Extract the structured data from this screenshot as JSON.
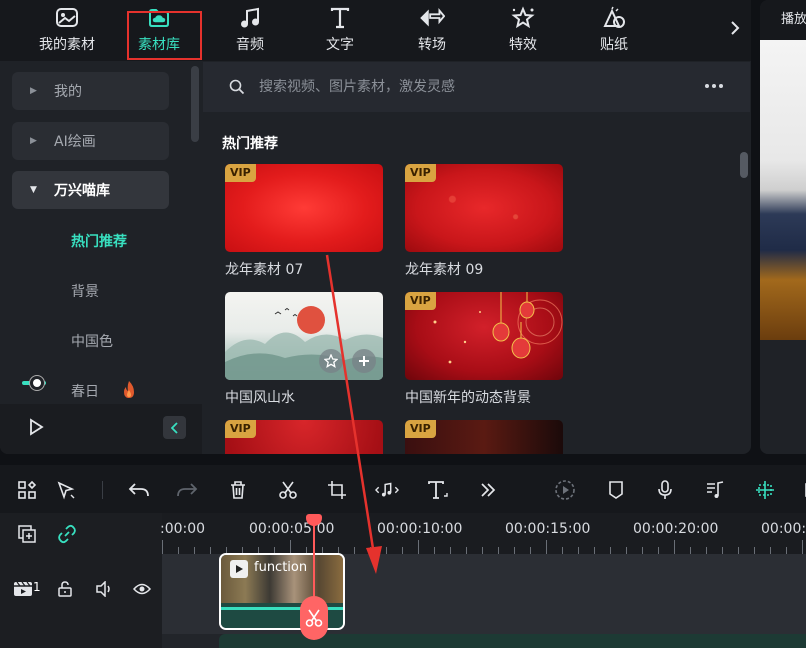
{
  "top_tabs": [
    {
      "label": "我的素材",
      "icon": "my-media-icon"
    },
    {
      "label": "素材库",
      "icon": "library-cloud-icon",
      "active": true
    },
    {
      "label": "音频",
      "icon": "music-note-icon"
    },
    {
      "label": "文字",
      "icon": "text-icon"
    },
    {
      "label": "转场",
      "icon": "transition-icon"
    },
    {
      "label": "特效",
      "icon": "effects-star-icon"
    },
    {
      "label": "贴纸",
      "icon": "sticker-icon"
    }
  ],
  "categories": [
    {
      "label": "我的",
      "expanded": false
    },
    {
      "label": "AI绘画",
      "expanded": false
    },
    {
      "label": "万兴喵库",
      "expanded": true
    }
  ],
  "subcategories": [
    {
      "label": "热门推荐",
      "active": true
    },
    {
      "label": "背景"
    },
    {
      "label": "中国色"
    },
    {
      "label": "春日"
    }
  ],
  "search": {
    "placeholder": "搜索视频、图片素材，激发灵感"
  },
  "section_title": "热门推荐",
  "cards": [
    {
      "label": "龙年素材 07",
      "vip": "VIP"
    },
    {
      "label": "龙年素材 09",
      "vip": "VIP"
    },
    {
      "label": "中国风山水",
      "vip": ""
    },
    {
      "label": "中国新年的动态背景",
      "vip": "VIP"
    },
    {
      "label": "",
      "vip": "VIP"
    },
    {
      "label": "",
      "vip": "VIP"
    }
  ],
  "preview": {
    "tab_label": "播放"
  },
  "ruler": {
    "labels": [
      ":00:00",
      "00:00:05:00",
      "00:00:10:00",
      "00:00:15:00",
      "00:00:20:00",
      "00:00:2"
    ]
  },
  "track": {
    "number": "1"
  },
  "clip": {
    "title": "function"
  },
  "colors": {
    "accent": "#38e0c0",
    "highlight_box": "#e5322d",
    "vip_badge": "#d9a441",
    "playhead": "#ff5a5a"
  }
}
